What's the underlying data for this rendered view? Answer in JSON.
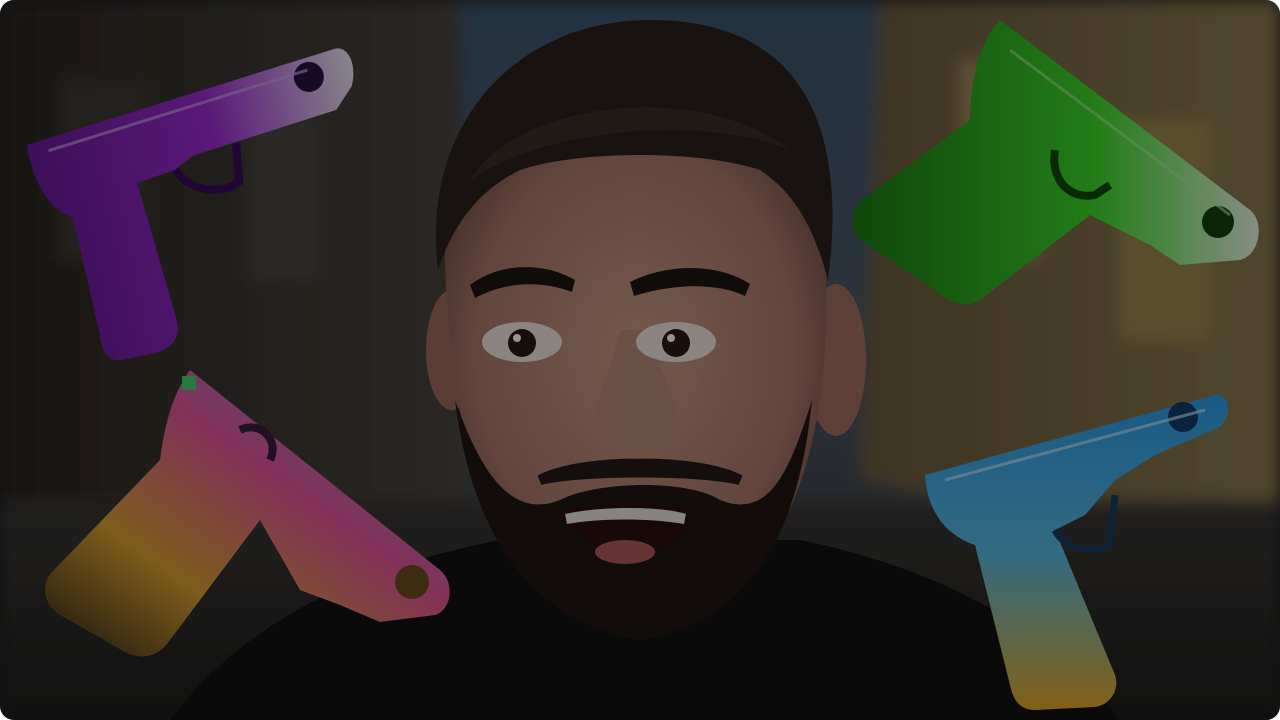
{
  "thumbnail": {
    "subject": "person-surprised",
    "items": [
      {
        "name": "pistol-purple",
        "color": "#8a1fc4"
      },
      {
        "name": "pistol-green",
        "color": "#2fc61f"
      },
      {
        "name": "pistol-rainbow",
        "color": "#e0559a"
      },
      {
        "name": "pistol-blue-gold",
        "color": "#2b9be6"
      }
    ],
    "overlay": "dimmed"
  }
}
